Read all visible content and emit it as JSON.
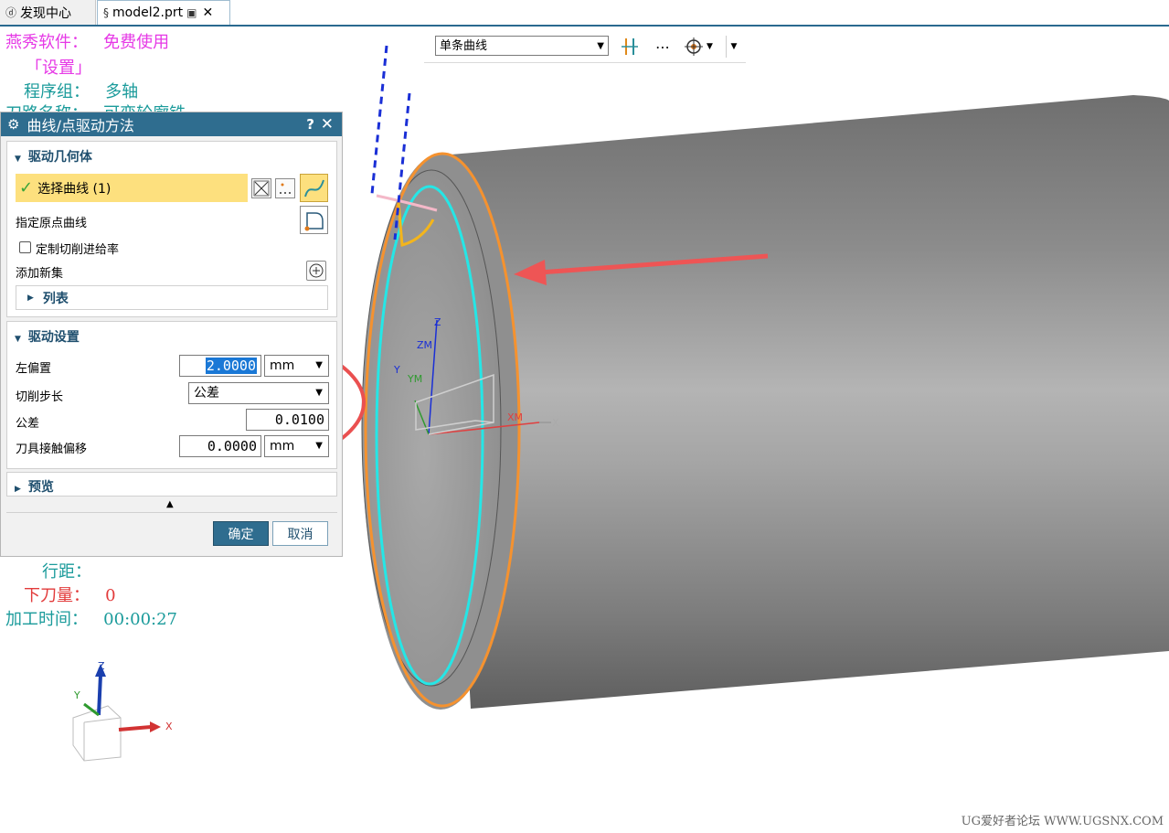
{
  "tabs": [
    {
      "label": "发现中心",
      "icon": "discovery-icon"
    },
    {
      "label": "model2.prt",
      "icon": "part-file-icon"
    }
  ],
  "info": {
    "software": "燕秀软件：   免费使用",
    "settings": "「设置」",
    "program_group": "程序组：   多轴",
    "toolpath_name": "刀路名称：   可变轮廓铣",
    "stepover": "行距：",
    "depth": "下刀量：   0",
    "time": "加工时间：   00:00:27"
  },
  "toolbar": {
    "filter_value": "单条曲线"
  },
  "dialog": {
    "title": "曲线/点驱动方法",
    "help": "?",
    "close": "✕",
    "drive_geometry": {
      "header": "驱动几何体",
      "select_curve": "选择曲线 (1)",
      "origin_curve": "指定原点曲线",
      "custom_feed": "定制切削进给率",
      "add_set": "添加新集",
      "list": "列表"
    },
    "drive_settings": {
      "header": "驱动设置",
      "left_offset_label": "左偏置",
      "left_offset_value": "2.0000",
      "left_offset_unit": "mm",
      "cut_step_label": "切削步长",
      "cut_step_value": "公差",
      "tolerance_label": "公差",
      "tolerance_value": "0.0100",
      "contact_offset_label": "刀具接触偏移",
      "contact_offset_value": "0.0000",
      "contact_offset_unit": "mm"
    },
    "preview": "预览",
    "ok": "确定",
    "cancel": "取消"
  },
  "viewport": {
    "csys_labels": {
      "z": "Z",
      "zm": "ZM",
      "y": "Y",
      "ym": "YM",
      "x": "X",
      "xm": "XM"
    },
    "triad_labels": {
      "z": "Z",
      "y": "Y",
      "x": "X"
    }
  },
  "watermark": "UG爱好者论坛 WWW.UGSNX.COM"
}
